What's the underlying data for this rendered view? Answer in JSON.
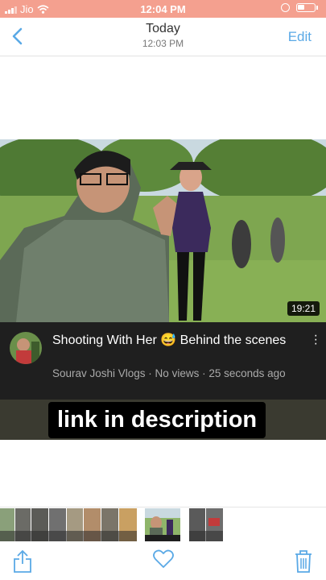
{
  "status_bar": {
    "carrier": "Jio",
    "time": "12:04 PM"
  },
  "nav": {
    "back_icon": "chevron-left-icon",
    "title": "Today",
    "subtitle": "12:03 PM",
    "edit_label": "Edit"
  },
  "video": {
    "duration": "19:21",
    "title": "Shooting With Her 😅 Behind the scenes",
    "channel": "Sourav Joshi Vlogs",
    "views": "No views",
    "age": "25 seconds ago",
    "subtitle_line": "Sourav Joshi Vlogs · No views · 25 seconds ago",
    "caption": "link in description"
  },
  "toolbar": {
    "share_icon": "share-icon",
    "favorite_icon": "heart-icon",
    "delete_icon": "trash-icon"
  },
  "colors": {
    "status_bar_bg": "#f4a08f",
    "accent": "#5aa9e6",
    "meta_bg": "#1f1f1f"
  }
}
